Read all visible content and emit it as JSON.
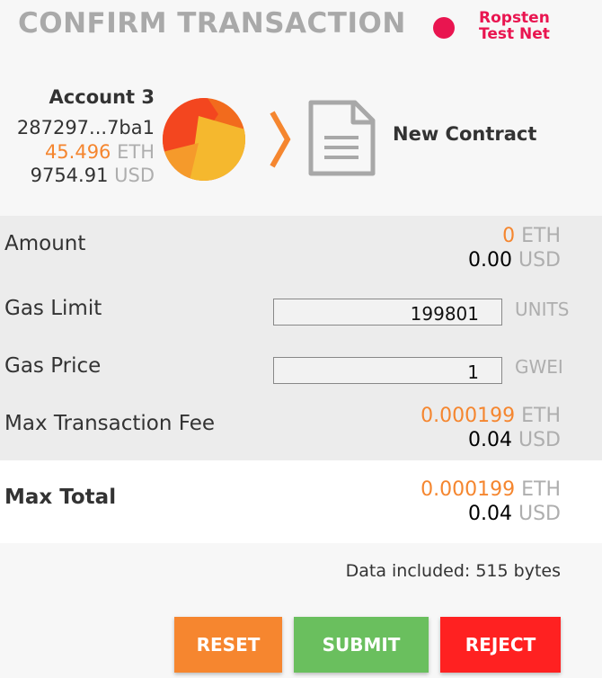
{
  "header": {
    "title": "CONFIRM TRANSACTION",
    "network_line1": "Ropsten",
    "network_line2": "Test Net",
    "network_color": "#e91550"
  },
  "account": {
    "name": "Account 3",
    "address": "287297...7ba1",
    "eth_balance": "45.496",
    "eth_unit": "ETH",
    "usd_balance": "9754.91",
    "usd_unit": "USD"
  },
  "recipient": {
    "icon": "document-icon",
    "label": "New Contract"
  },
  "details": {
    "amount": {
      "label": "Amount",
      "eth": "0",
      "eth_unit": "ETH",
      "usd": "0.00",
      "usd_unit": "USD"
    },
    "gas_limit": {
      "label": "Gas Limit",
      "value": "199801",
      "unit": "UNITS"
    },
    "gas_price": {
      "label": "Gas Price",
      "value": "1",
      "unit": "GWEI"
    },
    "max_fee": {
      "label": "Max Transaction Fee",
      "eth": "0.000199",
      "eth_unit": "ETH",
      "usd": "0.04",
      "usd_unit": "USD"
    }
  },
  "total": {
    "label": "Max Total",
    "eth": "0.000199",
    "eth_unit": "ETH",
    "usd": "0.04",
    "usd_unit": "USD"
  },
  "data_note": "Data included: 515 bytes",
  "buttons": {
    "reset": "RESET",
    "submit": "SUBMIT",
    "reject": "REJECT"
  },
  "colors": {
    "accent_orange": "#f5862f",
    "reset": "#f6862f",
    "submit": "#6abf5e",
    "reject": "#ff2121"
  }
}
